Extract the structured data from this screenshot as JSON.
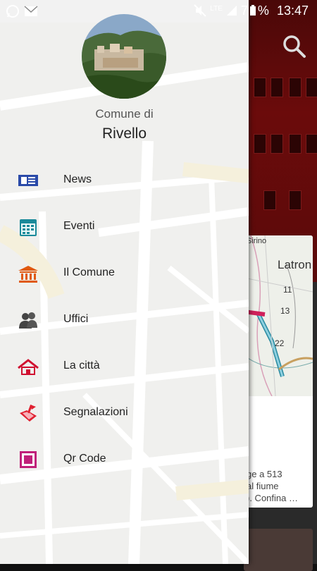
{
  "status_bar": {
    "time": "13:47",
    "battery_text": "7",
    "percent": "%",
    "network": "LTE"
  },
  "drawer": {
    "header": {
      "subtitle": "Comune di",
      "title": "Rivello"
    },
    "items": [
      {
        "label": "News",
        "icon": "newspaper-icon",
        "color": "#2a4aa8"
      },
      {
        "label": "Eventi",
        "icon": "calendar-icon",
        "color": "#1a8a9a"
      },
      {
        "label": "Il Comune",
        "icon": "town-hall-icon",
        "color": "#e05a10"
      },
      {
        "label": "Uffici",
        "icon": "people-icon",
        "color": "#444444"
      },
      {
        "label": "La città",
        "icon": "house-icon",
        "color": "#d01030"
      },
      {
        "label": "Segnalazioni",
        "icon": "report-icon",
        "color": "#e02030"
      },
      {
        "label": "Qr Code",
        "icon": "qr-code-icon",
        "color": "#c0207a"
      }
    ]
  },
  "background": {
    "card_map_labels": [
      "Sirino",
      "Latron",
      "11",
      "13",
      "22"
    ],
    "card_text": "ge a 513\nal fiume\n). Confina …"
  },
  "colors": {
    "header_red": "#6b0b0b",
    "drawer_bg": "#f2f2f2"
  }
}
